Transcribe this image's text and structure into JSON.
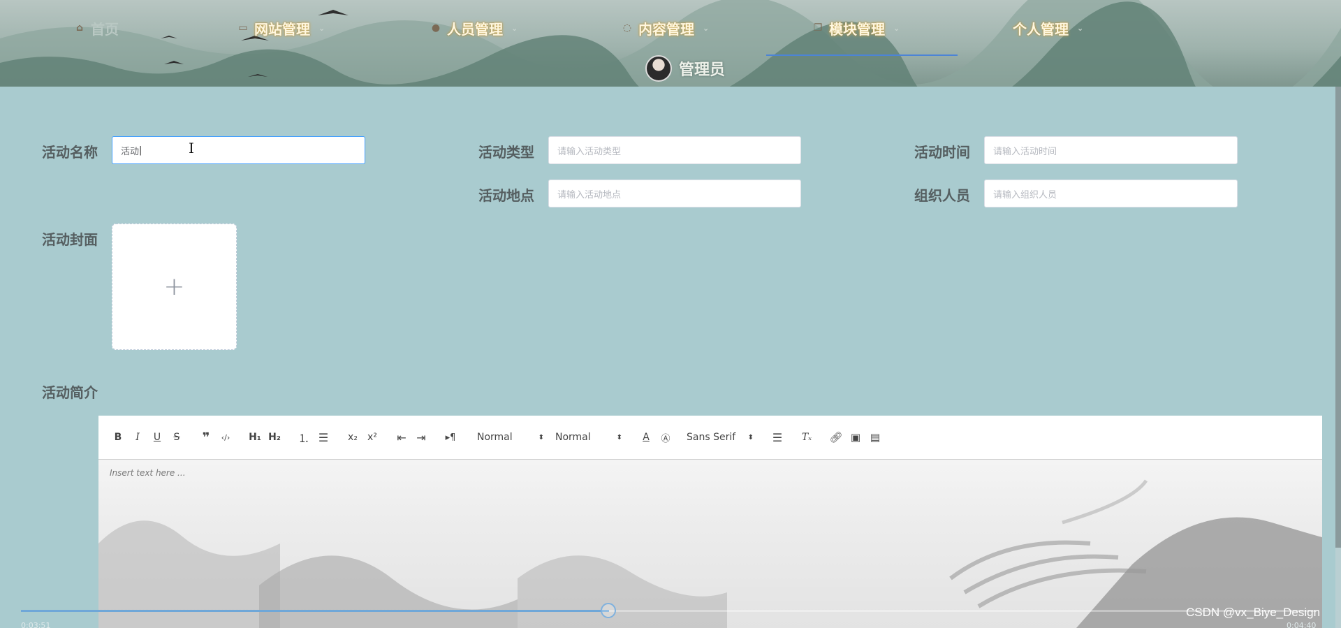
{
  "nav": {
    "items": [
      {
        "label": "首页",
        "icon": "home-icon",
        "active": false
      },
      {
        "label": "网站管理",
        "icon": "monitor-icon",
        "has_dropdown": true
      },
      {
        "label": "人员管理",
        "icon": "user-icon",
        "has_dropdown": true
      },
      {
        "label": "内容管理",
        "icon": "chat-icon",
        "has_dropdown": true
      },
      {
        "label": "模块管理",
        "icon": "copy-icon",
        "has_dropdown": true,
        "selected": true
      },
      {
        "label": "个人管理",
        "icon": null,
        "has_dropdown": true
      }
    ],
    "admin": "管理员",
    "accent_color": "#4c84d6"
  },
  "form": {
    "name_label": "活动名称",
    "name_value": "活动",
    "type_label": "活动类型",
    "type_placeholder": "请输入活动类型",
    "time_label": "活动时间",
    "time_placeholder": "请输入活动时间",
    "location_label": "活动地点",
    "location_placeholder": "请输入活动地点",
    "organizer_label": "组织人员",
    "organizer_placeholder": "请输入组织人员",
    "cover_label": "活动封面",
    "cover_upload_icon": "+",
    "intro_label": "活动简介"
  },
  "editor": {
    "header_select": "Normal",
    "size_select": "Normal",
    "font_select": "Sans Serif",
    "placeholder": "Insert text here ..."
  },
  "player": {
    "time_left": "0:03:51",
    "time_right": "0:04:40",
    "progress_percent": 45.4
  },
  "watermark": "CSDN @vx_Biye_Design",
  "colors": {
    "page_bg": "#a9cbcf",
    "focus_border": "#409eff"
  }
}
